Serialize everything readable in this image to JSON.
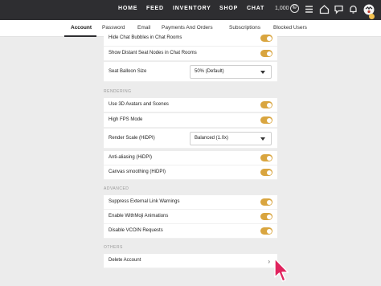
{
  "nav": {
    "items": [
      "HOME",
      "FEED",
      "INVENTORY",
      "SHOP",
      "CHAT"
    ],
    "vcoin_amount": "1,000",
    "vcoin_symbol": "©"
  },
  "tabs": [
    "Account",
    "Password",
    "Email",
    "Payments And Orders",
    "Subscriptions",
    "Blocked Users"
  ],
  "active_tab": "Account",
  "settings": {
    "hide_bubbles": {
      "label": "Hide Chat Bubbles in Chat Rooms",
      "on": true
    },
    "show_seat_nodes": {
      "label": "Show Distant Seat Nodes in Chat Rooms",
      "on": true
    },
    "seat_balloon": {
      "label": "Seat Balloon Size",
      "value": "50% (Default)"
    }
  },
  "rendering": {
    "title": "RENDERING",
    "avatars": {
      "label": "Use 3D Avatars and Scenes",
      "on": true
    },
    "fps": {
      "label": "High FPS Mode",
      "on": true
    },
    "render_scale": {
      "label": "Render Scale (HiDPI)",
      "value": "Balanced (1.0x)"
    },
    "antialias": {
      "label": "Anti-aliasing (HiDPI)",
      "on": true
    },
    "canvas": {
      "label": "Canvas smoothing (HiDPI)",
      "on": true
    }
  },
  "advanced": {
    "title": "ADVANCED",
    "suppress": {
      "label": "Suppress External Link Warnings",
      "on": true
    },
    "withmoji": {
      "label": "Enable WithMoji Animations",
      "on": true
    },
    "disable_vcoin": {
      "label": "Disable VCOIN Requests",
      "on": true
    }
  },
  "others": {
    "title": "OTHERS",
    "delete": {
      "label": "Delete Account",
      "chevron": "›"
    }
  },
  "colors": {
    "topbar": "#2e2e31",
    "toggle_on": "#d9a53f",
    "cursor": "#e0245e"
  }
}
